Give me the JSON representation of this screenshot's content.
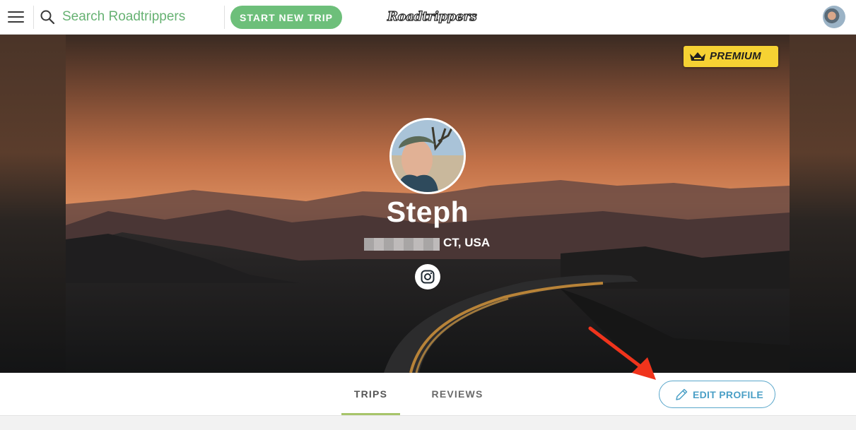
{
  "nav": {
    "search_placeholder": "Search Roadtrippers",
    "start_trip_label": "START NEW TRIP",
    "logo_text": "Roadtrippers"
  },
  "profile": {
    "badge_label": "PREMIUM",
    "name": "Steph",
    "location": "CT, USA"
  },
  "tabs": [
    {
      "label": "TRIPS",
      "active": true
    },
    {
      "label": "REVIEWS",
      "active": false
    }
  ],
  "edit_profile_label": "EDIT PROFILE",
  "colors": {
    "accent_green": "#6dbf7a",
    "tab_active": "#a7c56a",
    "edit_blue": "#4a9fc6",
    "premium_yellow": "#f6d233",
    "annotation_arrow": "#f0341c"
  },
  "icons": [
    "menu-icon",
    "search-icon",
    "crown-icon",
    "instagram-icon",
    "pencil-icon"
  ]
}
